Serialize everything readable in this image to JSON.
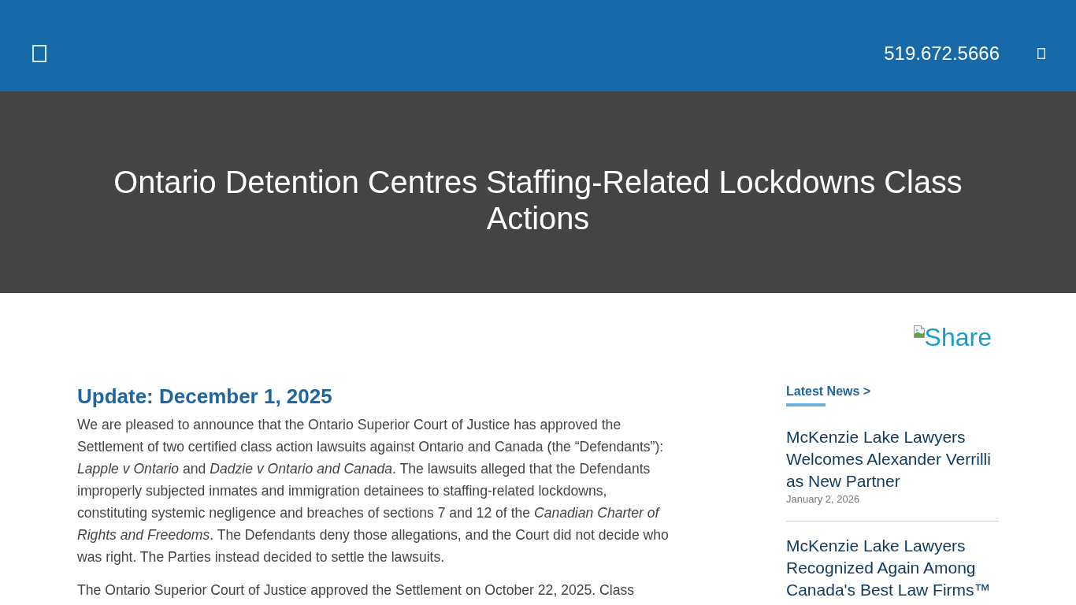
{
  "header": {
    "phone": "519.672.5666"
  },
  "hero": {
    "title": "Ontario Detention Centres Staffing-Related Lockdowns Class Actions"
  },
  "share": {
    "label": "Share"
  },
  "article": {
    "heading": "Update: December 1, 2025",
    "paragraphs": [
      "We are pleased to announce that the Ontario Superior Court of Justice has approved the Settlement of two certified class action lawsuits against Ontario and Canada (the “Defendants”): *Lapple v Ontario* and *Dadzie v Ontario and Canada*. The lawsuits alleged that the Defendants improperly subjected inmates and immigration detainees to staffing-related lockdowns, constituting systemic negligence and breaches of sections 7 and 12 of the *Canadian Charter of Rights and Freedoms*. The Defendants deny those allegations, and the Court did not decide who was right. The Parties instead decided to settle the lawsuits.",
      "The Ontario Superior Court of Justice approved the Settlement on October 22, 2025. Class"
    ]
  },
  "sidebar": {
    "title": "Latest News >",
    "news": [
      {
        "title": "McKenzie Lake Lawyers Welcomes Alexander Verrilli as New Partner",
        "date": "January 2, 2026"
      },
      {
        "title": "McKenzie Lake Lawyers Recognized Again Among Canada's Best Law Firms™"
      }
    ]
  }
}
